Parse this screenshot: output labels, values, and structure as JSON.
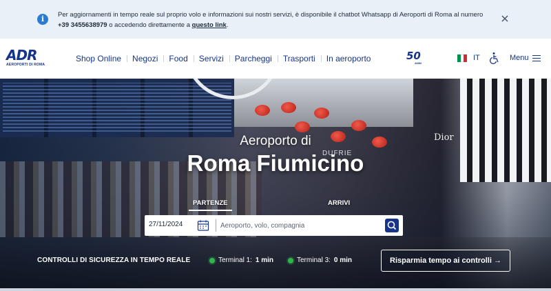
{
  "banner": {
    "text_before": "Per aggiornamenti in tempo reale sul proprio volo e informazioni sui nostri servizi, è disponibile il chatbot Whatsapp di Aeroporti di Roma al numero ",
    "phone": "+39 3455638979",
    "text_middle": " o accedendo direttamente a ",
    "link": "questo link",
    "text_after": "."
  },
  "header": {
    "logo_mark": "ADR",
    "logo_sub": "AEROPORTI DI ROMA",
    "nav": [
      "Shop Online",
      "Negozi",
      "Food",
      "Servizi",
      "Parcheggi",
      "Trasporti",
      "In aeroporto"
    ],
    "anniversary": "50",
    "anniversary_sub": "ANNI",
    "language": "IT",
    "menu_label": "Menu",
    "flag_colors": [
      "#009246",
      "#ffffff",
      "#ce2b37"
    ]
  },
  "hero": {
    "subtitle": "Aeroporto di",
    "title": "Roma Fiumicino",
    "scene_text_1": "Dior",
    "scene_text_2": "DUFRIE",
    "tabs": {
      "departures": "PARTENZE",
      "arrivals": "ARRIVI"
    },
    "search": {
      "date": "27/11/2024",
      "placeholder": "Aeroporto, volo, compagnia"
    },
    "security_label": "CONTROLLI DI SICUREZZA IN TEMPO REALE",
    "terminals": [
      {
        "name": "Terminal 1:",
        "time": "1 min"
      },
      {
        "name": "Terminal 3:",
        "time": "0 min"
      }
    ],
    "cta": "Risparmia tempo ai controlli →"
  },
  "colors": {
    "brand": "#16358a",
    "banner_bg": "#e9f0f8",
    "status_green": "#2fb54a"
  },
  "icons": {
    "info": "info-icon",
    "close": "close-icon",
    "accessibility": "wheelchair-icon",
    "menu": "hamburger-icon",
    "calendar": "calendar-icon",
    "search": "search-icon"
  }
}
